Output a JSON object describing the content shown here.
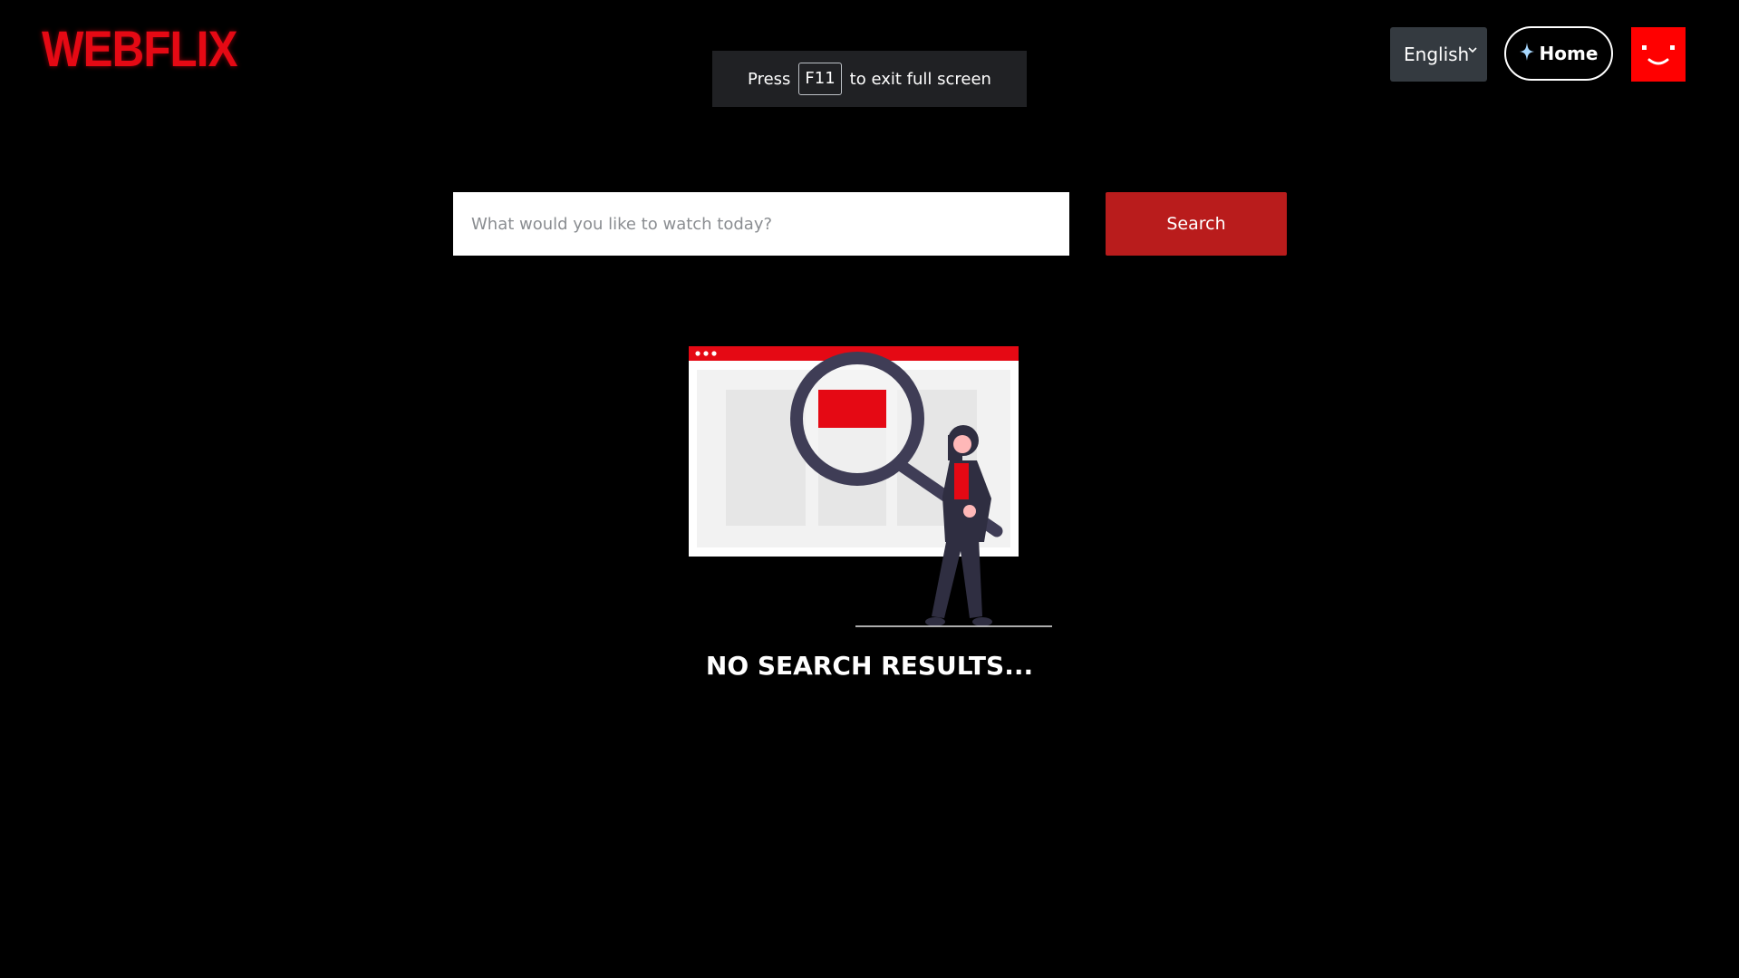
{
  "brand": {
    "logo_text": "WEBFLIX",
    "accent_color": "#e50914"
  },
  "fullscreen_toast": {
    "prefix": "Press",
    "key": "F11",
    "suffix": "to exit full screen"
  },
  "header": {
    "language": {
      "selected": "English",
      "chevron_icon": "chevron-down-icon"
    },
    "home_button": {
      "label": "Home",
      "icon": "sparkle-icon"
    },
    "avatar": {
      "icon": "smiley-avatar-icon",
      "color": "#ff0000"
    }
  },
  "search": {
    "placeholder": "What would you like to watch today?",
    "value": "",
    "button_label": "Search",
    "button_color": "#b91c1c"
  },
  "empty_state": {
    "illustration": "person-with-magnifier-illustration",
    "message": "NO SEARCH RESULTS..."
  }
}
